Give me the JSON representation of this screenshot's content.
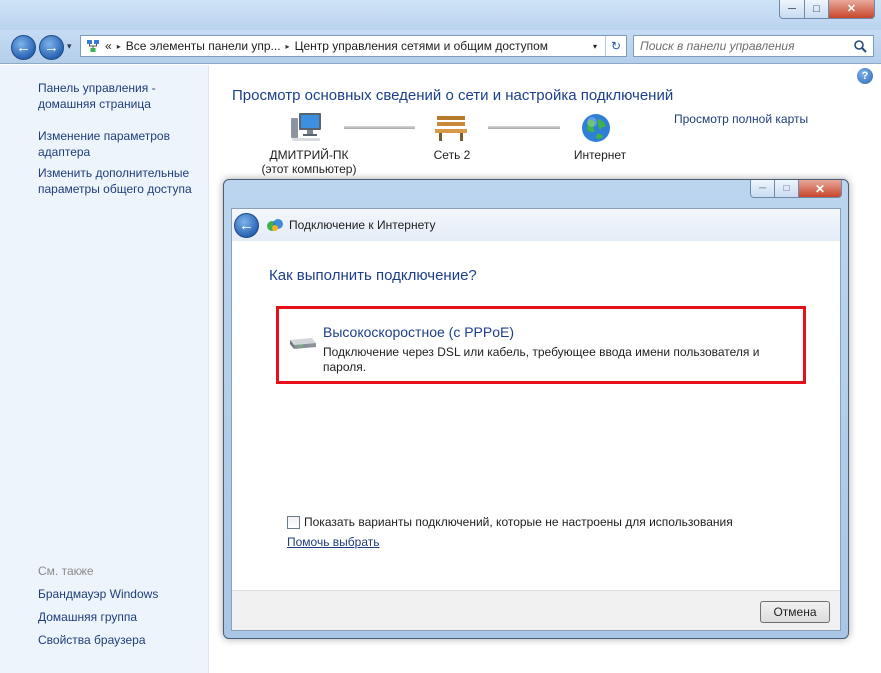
{
  "window": {
    "minimize_glyph": "─",
    "maximize_glyph": "□",
    "close_glyph": "✕"
  },
  "navbar": {
    "back_glyph": "←",
    "forward_glyph": "→",
    "dropdown_glyph": "▾"
  },
  "address": {
    "lead_separator": "«",
    "crumbs": [
      "Все элементы панели упр...",
      "Центр управления сетями и общим доступом"
    ],
    "crumb_separator": "▸",
    "dropdown_glyph": "▾",
    "refresh_glyph": "↻"
  },
  "search": {
    "placeholder": "Поиск в панели управления"
  },
  "left_pane": {
    "links": [
      {
        "line1": "Панель управления -",
        "line2": "домашняя страница"
      },
      {
        "line1": "Изменение параметров",
        "line2": "адаптера"
      },
      {
        "line1": "Изменить дополнительные",
        "line2": "параметры общего доступа"
      }
    ],
    "see_also_label": "См. также",
    "see_also": [
      "Брандмауэр Windows",
      "Домашняя группа",
      "Свойства браузера"
    ]
  },
  "main": {
    "title": "Просмотр основных сведений о сети и настройка подключений",
    "full_map_link": "Просмотр полной карты",
    "help_glyph": "?",
    "map": {
      "computer": {
        "line1": "ДМИТРИЙ-ПК",
        "line2": "(этот компьютер)"
      },
      "network": "Сеть  2",
      "internet": "Интернет"
    }
  },
  "dialog": {
    "title": "Подключение к Интернету",
    "back_glyph": "←",
    "minimize_glyph": "─",
    "maximize_glyph": "□",
    "close_glyph": "✕",
    "heading": "Как выполнить подключение?",
    "option": {
      "title": "Высокоскоростное (с PPPoE)",
      "description": "Подключение через DSL или кабель, требующее ввода имени пользователя и пароля."
    },
    "checkbox_label": "Показать варианты подключений, которые не настроены для использования",
    "help_link": "Помочь выбрать",
    "cancel_label": "Отмена"
  },
  "colors": {
    "accent": "#1c3f8c",
    "link": "#1e3d7a",
    "highlight_border": "#e5101a"
  }
}
